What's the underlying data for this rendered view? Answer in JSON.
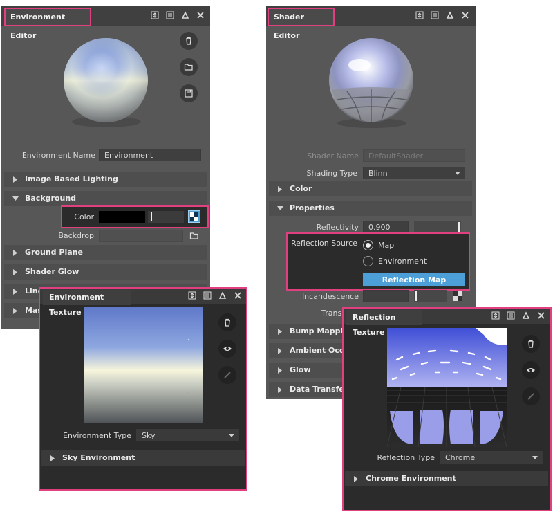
{
  "env_editor": {
    "title": "Environment Editor",
    "name_label": "Environment Name",
    "name_value": "Environment",
    "sections": [
      "Image Based Lighting",
      "Background",
      "Ground Plane",
      "Shader Glow",
      "Line",
      "Mas"
    ],
    "color_label": "Color",
    "backdrop_label": "Backdrop"
  },
  "env_texture": {
    "title": "Environment Texture",
    "type_label": "Environment Type",
    "type_value": "Sky",
    "section": "Sky Environment"
  },
  "shader_editor": {
    "title": "Shader Editor",
    "name_label": "Shader Name",
    "name_placeholder": "DefaultShader",
    "shading_label": "Shading Type",
    "shading_value": "Blinn",
    "sections": [
      "Color",
      "Properties",
      "Bump Mapping",
      "Ambient Occlus",
      "Glow",
      "Data Transfer In"
    ],
    "reflectivity_label": "Reflectivity",
    "reflectivity_value": "0.900",
    "reflection_source_label": "Reflection Source",
    "radio_map": "Map",
    "radio_environment": "Environment",
    "reflection_map_button": "Reflection Map",
    "incandescence_label": "Incandescence",
    "transparency_label": "Transpare"
  },
  "refl_texture": {
    "title": "Reflection Texture",
    "type_label": "Reflection Type",
    "type_value": "Chrome",
    "section": "Chrome Environment"
  },
  "colors": {
    "highlight": "#e0407f",
    "accent_button": "#4d9fd8",
    "panel": "#575757"
  },
  "icons": [
    "trash-icon",
    "folder-icon",
    "save-icon",
    "eye-icon",
    "disable-icon",
    "resize-icon",
    "menu-icon",
    "triangle-icon",
    "close-icon"
  ]
}
